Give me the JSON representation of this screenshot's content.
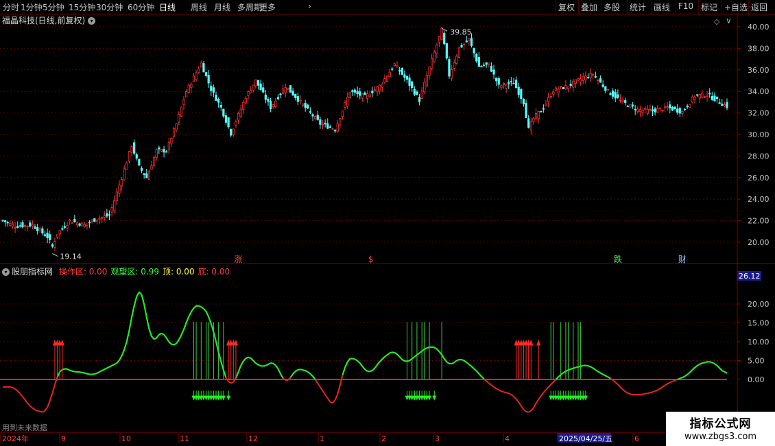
{
  "toolbar": {
    "left": [
      "分时",
      "1分钟",
      "5分钟",
      "15分钟",
      "30分钟",
      "60分钟",
      "日线",
      "周线",
      "月线",
      "多周期",
      "更多"
    ],
    "active": "日线",
    "right": [
      "复权",
      "叠加",
      "多股",
      "统计",
      "画线",
      "F10",
      "标记",
      "+自选",
      "返回"
    ]
  },
  "main": {
    "title": "福晶科技(日线,前复权)",
    "ytick_labels": [
      "40.00",
      "38.00",
      "36.00",
      "34.00",
      "32.00",
      "30.00",
      "28.00",
      "26.00",
      "24.00",
      "22.00",
      "20.00"
    ],
    "high_label": "39.85",
    "low_label": "19.14",
    "event_labels": [
      {
        "text": "涨",
        "color": "#ff4040"
      },
      {
        "text": "$",
        "color": "#ff4040"
      },
      {
        "text": "跌",
        "color": "#40ff40"
      },
      {
        "text": "财",
        "color": "#8ecbff"
      },
      {
        "text": "$",
        "color": "#ff4040"
      }
    ]
  },
  "indicator": {
    "name": "股朋指标网",
    "fields": [
      {
        "label": "操作区:",
        "value": "0.00",
        "color": "#ff3c3c"
      },
      {
        "label": "观望区:",
        "value": "0.99",
        "color": "#3cff3c"
      },
      {
        "label": "顶:",
        "value": "0.00",
        "color": "#ffff3c"
      },
      {
        "label": "底:",
        "value": "0.00",
        "color": "#ff3c3c"
      }
    ],
    "ytick_labels": [
      "20.00",
      "15.00",
      "10.00",
      "5.00",
      "0.00"
    ],
    "current_value": "26.12",
    "future_note": "用到未来数据"
  },
  "xaxis": {
    "labels": [
      "2024年",
      "9",
      "10",
      "11",
      "12",
      "1",
      "2",
      "3",
      "4",
      "2025/04/25/五",
      "6"
    ]
  },
  "watermark": {
    "line1": "指标公式网",
    "line2": "www.zbgs3.com"
  },
  "chart_data": {
    "type": "candlestick",
    "series_up_color": "#ff3232",
    "series_down_color": "#54ffff",
    "ylim_price": [
      19,
      40.8
    ],
    "ylim_indicator": [
      -13,
      27
    ],
    "keypoints": {
      "price": [
        [
          0,
          22
        ],
        [
          5,
          21.5
        ],
        [
          12,
          21.6
        ],
        [
          18,
          20.5
        ],
        [
          20,
          19.6
        ],
        [
          22,
          20.8
        ],
        [
          27,
          22
        ],
        [
          33,
          21.6
        ],
        [
          38,
          22.2
        ],
        [
          43,
          22.5
        ],
        [
          48,
          26.0
        ],
        [
          52,
          29
        ],
        [
          55,
          27
        ],
        [
          58,
          26
        ],
        [
          62,
          28.5
        ],
        [
          66,
          28.5
        ],
        [
          70,
          31
        ],
        [
          74,
          34
        ],
        [
          80,
          36.6
        ],
        [
          84,
          34.2
        ],
        [
          88,
          32.5
        ],
        [
          92,
          30.1
        ],
        [
          98,
          33.5
        ],
        [
          102,
          35
        ],
        [
          108,
          32.5
        ],
        [
          114,
          34.5
        ],
        [
          120,
          33.0
        ],
        [
          128,
          31.0
        ],
        [
          134,
          30.5
        ],
        [
          140,
          34
        ],
        [
          146,
          33.5
        ],
        [
          152,
          34.5
        ],
        [
          158,
          36.5
        ],
        [
          163,
          35.0
        ],
        [
          168,
          33.2
        ],
        [
          172,
          36.2
        ],
        [
          177,
          39.7
        ],
        [
          180,
          35.5
        ],
        [
          184,
          38.0
        ],
        [
          188,
          38.8
        ],
        [
          192,
          36.3
        ],
        [
          196,
          36.5
        ],
        [
          200,
          34.5
        ],
        [
          206,
          34.8
        ],
        [
          210,
          33.0
        ],
        [
          212,
          30.5
        ],
        [
          214,
          31.5
        ],
        [
          218,
          32.5
        ],
        [
          222,
          34.1
        ],
        [
          228,
          34.5
        ],
        [
          234,
          35.3
        ],
        [
          238,
          35.6
        ],
        [
          244,
          34.0
        ],
        [
          250,
          33.0
        ],
        [
          256,
          32.3
        ],
        [
          262,
          32.2
        ],
        [
          268,
          32.5
        ],
        [
          274,
          32.1
        ],
        [
          279,
          33.6
        ],
        [
          284,
          33.7
        ],
        [
          289,
          33.0
        ],
        [
          292,
          32.6
        ]
      ],
      "indicator": [
        [
          0,
          -2
        ],
        [
          5,
          -2
        ],
        [
          12,
          -8
        ],
        [
          18,
          -9
        ],
        [
          20,
          -4
        ],
        [
          21,
          0
        ],
        [
          24,
          3.5
        ],
        [
          28,
          2
        ],
        [
          32,
          2
        ],
        [
          36,
          1
        ],
        [
          42,
          3
        ],
        [
          48,
          5
        ],
        [
          52,
          15
        ],
        [
          54,
          25
        ],
        [
          56,
          25
        ],
        [
          60,
          8
        ],
        [
          64,
          14
        ],
        [
          68,
          8
        ],
        [
          72,
          11
        ],
        [
          76,
          19
        ],
        [
          80,
          20
        ],
        [
          84,
          16
        ],
        [
          88,
          4
        ],
        [
          92,
          -3
        ],
        [
          98,
          7
        ],
        [
          104,
          3
        ],
        [
          110,
          5
        ],
        [
          114,
          -2
        ],
        [
          118,
          3
        ],
        [
          124,
          2
        ],
        [
          130,
          -4
        ],
        [
          134,
          -8
        ],
        [
          138,
          5
        ],
        [
          142,
          6
        ],
        [
          148,
          1
        ],
        [
          152,
          5
        ],
        [
          158,
          8
        ],
        [
          162,
          4
        ],
        [
          168,
          7
        ],
        [
          172,
          9
        ],
        [
          176,
          8
        ],
        [
          180,
          3
        ],
        [
          184,
          6
        ],
        [
          190,
          3
        ],
        [
          194,
          0
        ],
        [
          200,
          -3
        ],
        [
          206,
          -4
        ],
        [
          212,
          -10
        ],
        [
          216,
          -5
        ],
        [
          220,
          -2
        ],
        [
          226,
          2
        ],
        [
          230,
          3
        ],
        [
          236,
          4
        ],
        [
          240,
          2
        ],
        [
          246,
          0
        ],
        [
          252,
          -4
        ],
        [
          258,
          -4
        ],
        [
          264,
          -3
        ],
        [
          268,
          -1
        ],
        [
          272,
          0
        ],
        [
          276,
          1
        ],
        [
          280,
          4
        ],
        [
          286,
          5
        ],
        [
          292,
          1
        ]
      ]
    },
    "up_arrow_x": [
      21,
      22,
      23,
      24,
      91,
      92,
      93,
      94,
      207,
      208,
      209,
      210,
      211,
      212,
      213,
      216
    ],
    "down_arrow_x": [
      77,
      78,
      79,
      80,
      81,
      82,
      83,
      84,
      85,
      86,
      87,
      88,
      89,
      91,
      163,
      164,
      165,
      166,
      167,
      168,
      169,
      170,
      171,
      172,
      174,
      221,
      222,
      223,
      224,
      225,
      226,
      227,
      228,
      229,
      230,
      231,
      232,
      233,
      234,
      235
    ],
    "vline_green_x": [
      77,
      78,
      80,
      82,
      83,
      85,
      87,
      89,
      163,
      165,
      167,
      169,
      170,
      172,
      177,
      221,
      222,
      225,
      227,
      228,
      230,
      232,
      233
    ]
  }
}
